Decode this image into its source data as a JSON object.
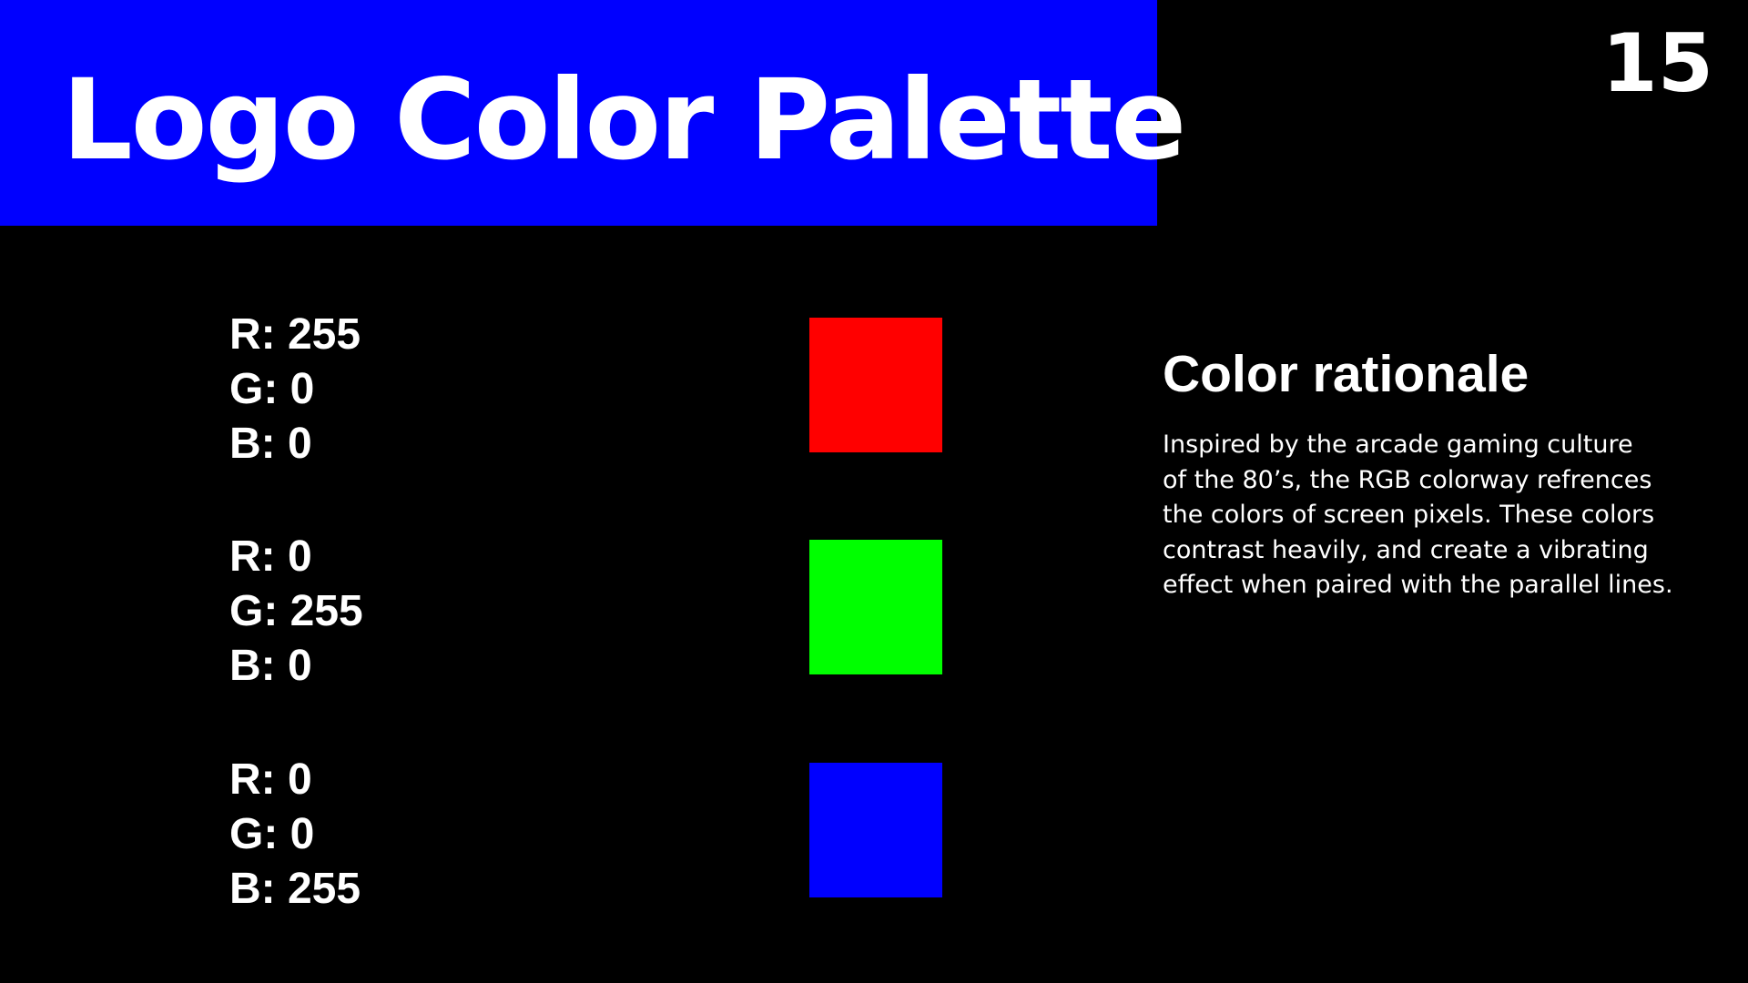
{
  "slide": {
    "title": "Logo Color Palette",
    "page_number": "15",
    "colors": {
      "background": "#000000",
      "title_bar": "#0000ff",
      "text": "#ffffff"
    }
  },
  "palette": [
    {
      "r_label": "R: 255",
      "g_label": "G: 0",
      "b_label": "B: 0",
      "swatch_color": "#ff0000"
    },
    {
      "r_label": "R: 0",
      "g_label": "G: 255",
      "b_label": "B: 0",
      "swatch_color": "#00ff00"
    },
    {
      "r_label": "R: 0",
      "g_label": "G: 0",
      "b_label": "B: 255",
      "swatch_color": "#0000ff"
    }
  ],
  "rationale": {
    "heading": "Color rationale",
    "body_lines": [
      "Inspired by the arcade gaming culture",
      "of the 80’s, the RGB colorway refrences",
      "the colors of screen pixels. These colors",
      "contrast heavily, and create a vibrating",
      "effect when paired with the parallel lines."
    ]
  }
}
